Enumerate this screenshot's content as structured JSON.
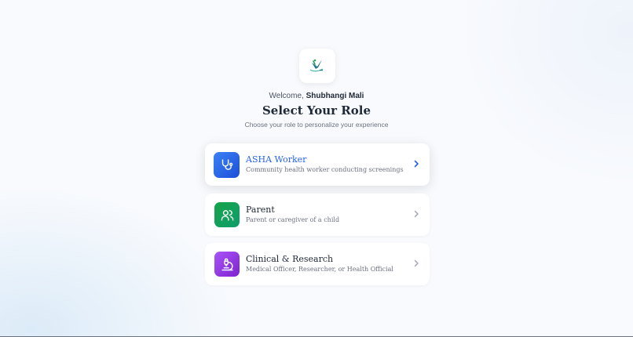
{
  "header": {
    "welcome_prefix": "Welcome, ",
    "user_name": "Shubhangi Mali",
    "title": "Select Your Role",
    "subtitle": "Choose your role to personalize your experience"
  },
  "roles": [
    {
      "title": "ASHA Worker",
      "description": "Community health worker conducting screenings",
      "icon": "stethoscope-icon",
      "color_start": "#3b82f6",
      "color_end": "#1d4ed8",
      "title_color": "#2563eb",
      "selected": true
    },
    {
      "title": "Parent",
      "description": "Parent or caregiver of a child",
      "icon": "users-icon",
      "color_start": "#16a34a",
      "color_end": "#0f9d6b",
      "title_color": "#1f2937",
      "selected": false
    },
    {
      "title": "Clinical & Research",
      "description": "Medical Officer, Researcher, or Health Official",
      "icon": "microscope-icon",
      "color_start": "#a855f7",
      "color_end": "#7e22ce",
      "title_color": "#1f2937",
      "selected": false
    }
  ],
  "colors": {
    "chevron_active": "#2563eb",
    "chevron_inactive": "#9ca3af"
  }
}
